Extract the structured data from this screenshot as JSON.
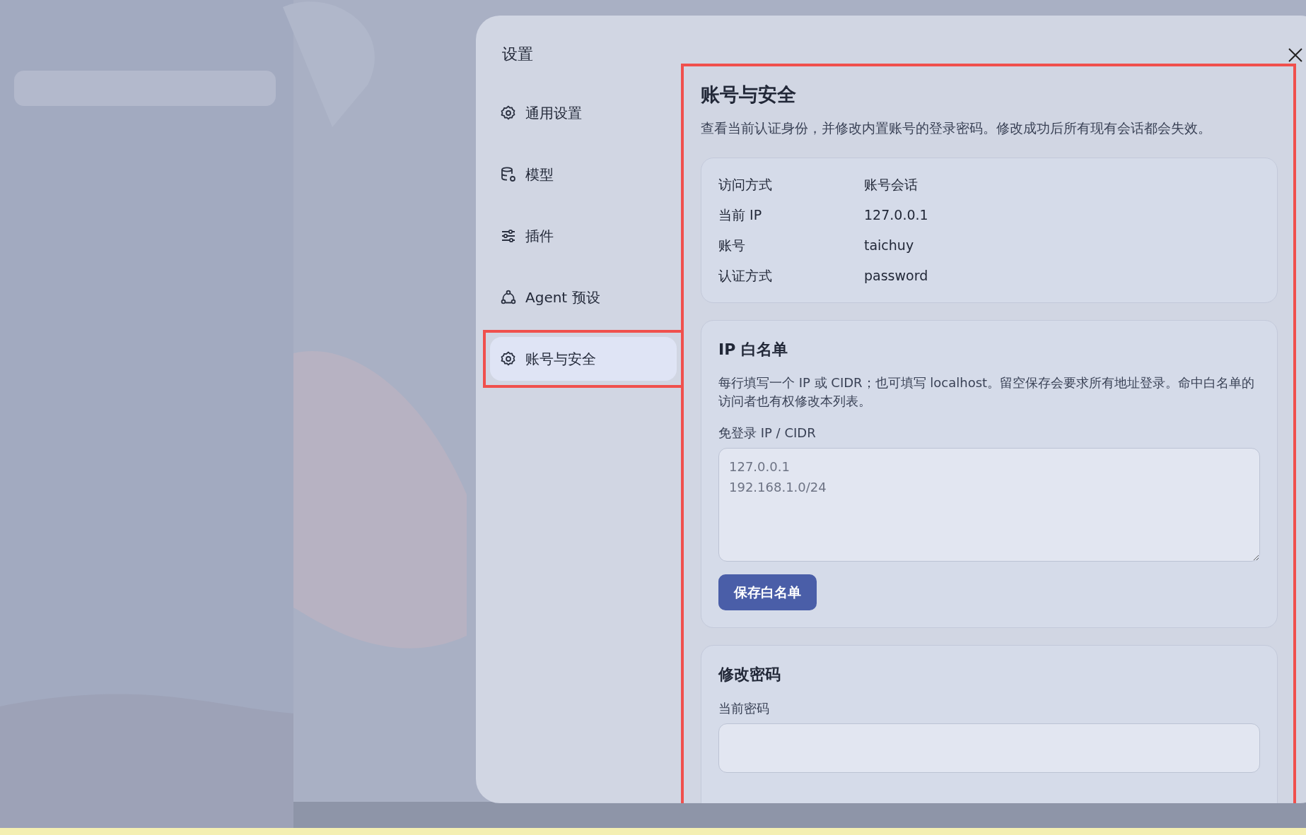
{
  "dialog": {
    "title": "设置",
    "nav": [
      {
        "label": "通用设置",
        "selected": false,
        "annotated": false
      },
      {
        "label": "模型",
        "selected": false,
        "annotated": false
      },
      {
        "label": "插件",
        "selected": false,
        "annotated": false
      },
      {
        "label": "Agent 预设",
        "selected": false,
        "annotated": false
      },
      {
        "label": "账号与安全",
        "selected": true,
        "annotated": true
      }
    ],
    "content": {
      "annotated": true,
      "title": "账号与安全",
      "description": "查看当前认证身份，并修改内置账号的登录密码。修改成功后所有现有会话都会失效。",
      "info": [
        {
          "label": "访问方式",
          "value": "账号会话"
        },
        {
          "label": "当前 IP",
          "value": "127.0.0.1"
        },
        {
          "label": "账号",
          "value": "taichuy"
        },
        {
          "label": "认证方式",
          "value": "password"
        }
      ],
      "whitelist": {
        "title": "IP 白名单",
        "description": "每行填写一个 IP 或 CIDR；也可填写 localhost。留空保存会要求所有地址登录。命中白名单的访问者也有权修改本列表。",
        "field_label": "免登录 IP / CIDR",
        "placeholder": "127.0.0.1\n192.168.1.0/24",
        "button": "保存白名单"
      },
      "password": {
        "title": "修改密码",
        "field_label": "当前密码"
      }
    }
  }
}
